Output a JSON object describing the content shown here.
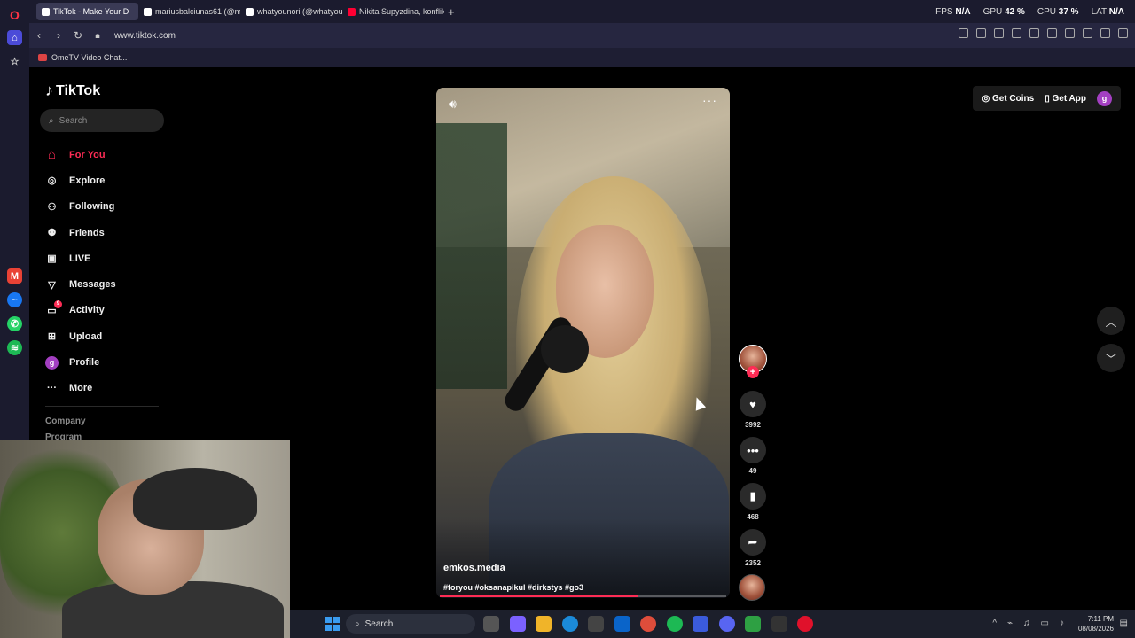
{
  "browser": {
    "tabs": [
      {
        "label": "TikTok - Make Your D",
        "active": true,
        "favicon": "tiktok-icon"
      },
      {
        "label": "mariusbalciunas61 (@mar",
        "active": false,
        "favicon": "tiktok-icon"
      },
      {
        "label": "whatyounori (@whatyoun",
        "active": false,
        "favicon": "tiktok-icon"
      },
      {
        "label": "Nikita Supyzdina, konfliktai",
        "active": false,
        "favicon": "youtube-icon"
      }
    ],
    "new_tab": "+",
    "perf": {
      "fps_label": "FPS",
      "fps_value": "N/A",
      "gpu_label": "GPU",
      "gpu_value": "42 %",
      "cpu_label": "CPU",
      "cpu_value": "37 %",
      "lat_label": "LAT",
      "lat_value": "N/A"
    },
    "url": "www.tiktok.com",
    "bookmark": "OmeTV Video Chat..."
  },
  "tiktok": {
    "brand": "TikTok",
    "search_placeholder": "Search",
    "menu": [
      {
        "label": "For You",
        "icon": "home-icon",
        "active": true
      },
      {
        "label": "Explore",
        "icon": "compass-icon",
        "active": false
      },
      {
        "label": "Following",
        "icon": "user-plus-icon",
        "active": false
      },
      {
        "label": "Friends",
        "icon": "friends-icon",
        "active": false
      },
      {
        "label": "LIVE",
        "icon": "live-tv-icon",
        "active": false
      },
      {
        "label": "Messages",
        "icon": "send-icon",
        "active": false
      },
      {
        "label": "Activity",
        "icon": "inbox-icon",
        "active": false,
        "badge": "9"
      },
      {
        "label": "Upload",
        "icon": "plus-square-icon",
        "active": false
      },
      {
        "label": "Profile",
        "icon": "avatar-icon",
        "active": false,
        "avatar_letter": "g"
      },
      {
        "label": "More",
        "icon": "more-icon",
        "active": false
      }
    ],
    "footer_links": [
      "Company",
      "Program"
    ],
    "header": {
      "get_coins": "Get Coins",
      "get_app": "Get App",
      "avatar_letter": "g"
    },
    "video": {
      "author": "emkos.media",
      "caption": "#foryou #oksanapikul #dirkstys #go3",
      "progress": 0.69
    },
    "actions": {
      "likes": "3992",
      "comments": "49",
      "saves": "468",
      "shares": "2352",
      "follow": "+"
    },
    "colors": {
      "accent": "#fe2c55",
      "background": "#000000"
    }
  },
  "taskbar": {
    "search_placeholder": "Search",
    "time": "7:11 PM",
    "date": "08/08/2026"
  }
}
